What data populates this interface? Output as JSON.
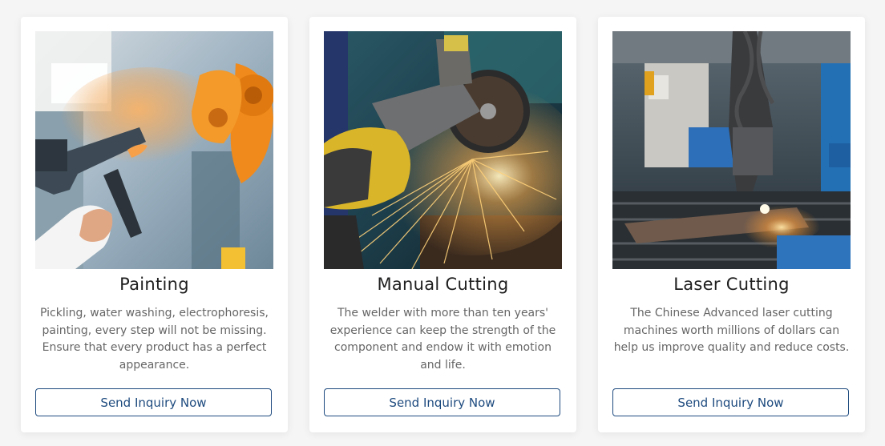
{
  "colors": {
    "accent": "#1d4a7e",
    "title": "#1e1e1e",
    "body_text": "#666666",
    "card_bg": "#ffffff",
    "page_bg": "#f5f5f5"
  },
  "cards": [
    {
      "title": "Painting",
      "description": "Pickling, water washing, electrophoresis, painting, every step will not be missing. Ensure that every product has a perfect appearance.",
      "button_label": "Send Inquiry Now",
      "image_subject": "worker spray painting with orange paint gun"
    },
    {
      "title": "Manual Cutting",
      "description": "The welder with more than ten years' experience can keep the strength of the component and endow it with emotion and life.",
      "button_label": "Send Inquiry Now",
      "image_subject": "angle grinder cutting metal with sparks"
    },
    {
      "title": "Laser Cutting",
      "description": "The Chinese Advanced laser cutting machines worth millions of dollars can help us improve quality and reduce costs.",
      "button_label": "Send Inquiry Now",
      "image_subject": "laser cutting machine over steel plate"
    }
  ]
}
